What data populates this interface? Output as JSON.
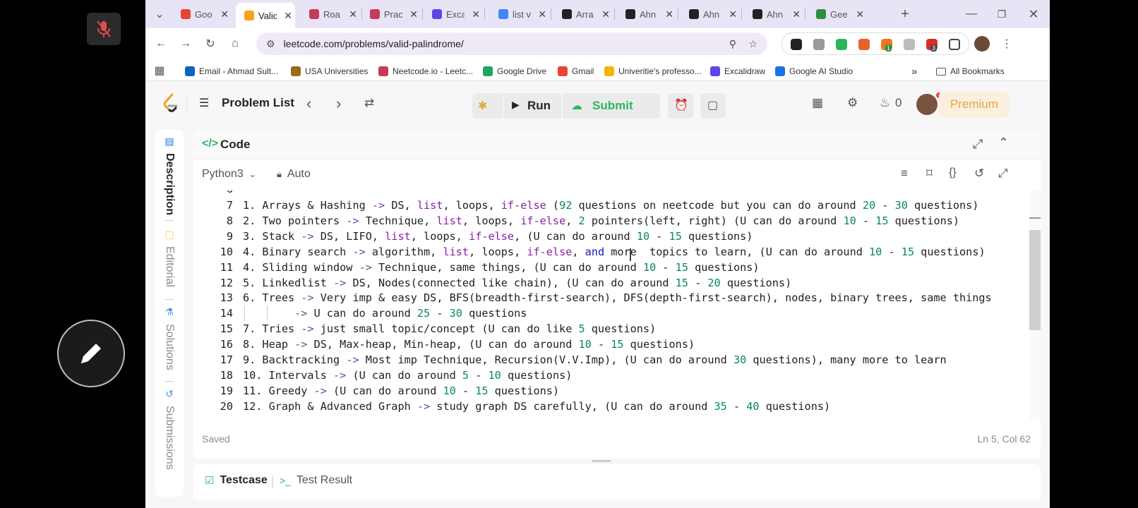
{
  "browser": {
    "tabs": [
      {
        "title": "Goo",
        "favicon_color": "#ea4335",
        "active": false
      },
      {
        "title": "Valid",
        "favicon_color": "#f7a21c",
        "active": true
      },
      {
        "title": "Roa",
        "favicon_color": "#c73a5a",
        "active": false
      },
      {
        "title": "Prac",
        "favicon_color": "#c73a5a",
        "active": false
      },
      {
        "title": "Exca",
        "favicon_color": "#5b47e8",
        "active": false
      },
      {
        "title": "list v",
        "favicon_color": "#4285f4",
        "active": false
      },
      {
        "title": "Arra",
        "favicon_color": "#222222",
        "active": false
      },
      {
        "title": "Ahn",
        "favicon_color": "#222222",
        "active": false
      },
      {
        "title": "Ahn",
        "favicon_color": "#222222",
        "active": false
      },
      {
        "title": "Ahn",
        "favicon_color": "#222222",
        "active": false
      },
      {
        "title": "Gee",
        "favicon_color": "#2f8d46",
        "active": false
      }
    ],
    "url": "leetcode.com/problems/valid-palindrome/",
    "extension_badges": {
      "green": "1",
      "red": "3"
    },
    "bookmarks": [
      {
        "label": "Email - Ahmad Sult...",
        "color": "#0b64c2"
      },
      {
        "label": "USA Universities",
        "color": "#9a6a1c"
      },
      {
        "label": "Neetcode.io - Leetc...",
        "color": "#c73a5a"
      },
      {
        "label": "Google Drive",
        "color": "#1fa463"
      },
      {
        "label": "Gmail",
        "color": "#ea4335"
      },
      {
        "label": "Univeritie's professo...",
        "color": "#f4b400"
      },
      {
        "label": "Excalidraw",
        "color": "#5b47e8"
      },
      {
        "label": "Google AI Studio",
        "color": "#1a73e8"
      }
    ],
    "more_bookmarks": "»",
    "all_bookmarks": "All Bookmarks"
  },
  "leetcode": {
    "problem_list": "Problem List",
    "run": "Run",
    "submit": "Submit",
    "streak": "0",
    "premium": "Premium",
    "side_tabs": [
      "Description",
      "Editorial",
      "Solutions",
      "Submissions"
    ],
    "code_title": "Code",
    "code_icon": "</>",
    "language": "Python3",
    "mode": "Auto",
    "saved": "Saved",
    "cursor_position": "Ln 5, Col 62",
    "testcase": "Testcase",
    "test_result": "Test Result"
  },
  "code_lines": [
    {
      "n": "6",
      "text": ""
    },
    {
      "n": "7",
      "text": "1. Arrays & Hashing -> DS, list, loops, if-else (92 questions on neetcode but you can do around 20 - 30 questions)"
    },
    {
      "n": "8",
      "text": "2. Two pointers -> Technique, list, loops, if-else, 2 pointers(left, right) (U can do around 10 - 15 questions)"
    },
    {
      "n": "9",
      "text": "3. Stack -> DS, LIFO, list, loops, if-else, (U can do around 10 - 15 questions)"
    },
    {
      "n": "10",
      "text": "4. Binary search -> algorithm, list, loops, if-else, and more  topics to learn, (U can do around 10 - 15 questions)"
    },
    {
      "n": "11",
      "text": "4. Sliding window -> Technique, same things, (U can do around 10 - 15 questions)"
    },
    {
      "n": "12",
      "text": "5. Linkedlist -> DS, Nodes(connected like chain), (U can do around 15 - 20 questions)"
    },
    {
      "n": "13",
      "text": "6. Trees -> Very imp & easy DS, BFS(breadth-first-search), DFS(depth-first-search), nodes, binary trees, same things"
    },
    {
      "n": "14",
      "text": "        -> U can do around 25 - 30 questions"
    },
    {
      "n": "15",
      "text": "7. Tries -> just small topic/concept (U can do like 5 questions)"
    },
    {
      "n": "16",
      "text": "8. Heap -> DS, Max-heap, Min-heap, (U can do around 10 - 15 questions)"
    },
    {
      "n": "17",
      "text": "9. Backtracking -> Most imp Technique, Recursion(V.V.Imp), (U can do around 30 questions), many more to learn"
    },
    {
      "n": "18",
      "text": "10. Intervals -> (U can do around 5 - 10 questions)"
    },
    {
      "n": "19",
      "text": "11. Greedy -> (U can do around 10 - 15 questions)"
    },
    {
      "n": "20",
      "text": "12. Graph & Advanced Graph -> study graph DS carefully, (U can do around 35 - 40 questions)"
    }
  ],
  "colors": {
    "tabstrip": "#e9e4f5",
    "run_submit_bg": "#ebebec",
    "submit_green": "#2db55d",
    "premium_text": "#e3a63b",
    "code_number": "#09885a",
    "code_keyword": "#8b1fa8",
    "code_operator": "#7a3e9d"
  }
}
